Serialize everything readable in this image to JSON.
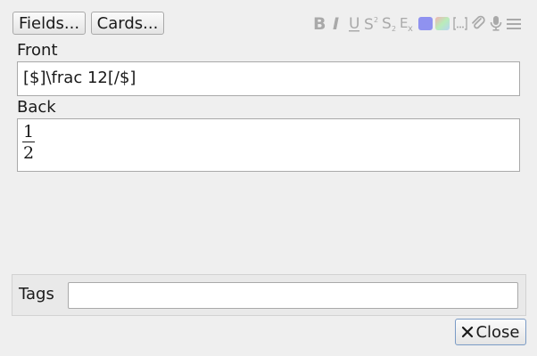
{
  "header": {
    "fields_label": "Fields...",
    "cards_label": "Cards..."
  },
  "toolbar": {
    "items": [
      "bold-icon",
      "italic-icon",
      "underline-icon",
      "superscript-icon",
      "subscript-icon",
      "clear-formatting-icon",
      "text-color-icon",
      "highlight-color-icon",
      "cloze-icon",
      "attach-icon",
      "record-audio-icon",
      "more-menu-icon"
    ],
    "text_color": "#8f92f0",
    "highlight_colors": [
      "#f3b3b3",
      "#b9ecb9",
      "#b7d4f3"
    ]
  },
  "fields": [
    {
      "label": "Front",
      "value": "[$]\\frac 12[/$]"
    },
    {
      "label": "Back",
      "rendered_fraction": {
        "numerator": "1",
        "denominator": "2"
      }
    }
  ],
  "tags": {
    "label": "Tags",
    "value": ""
  },
  "footer": {
    "close_label": "Close"
  }
}
